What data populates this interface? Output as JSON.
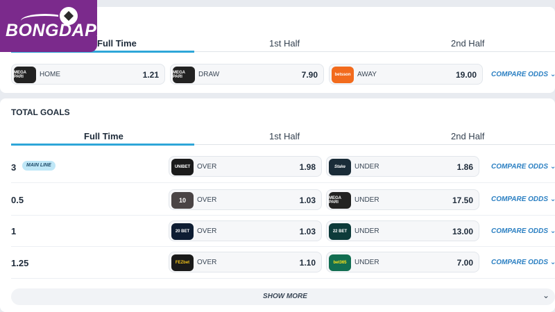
{
  "logo": {
    "text": "BONGDAPI"
  },
  "tabs": [
    "Full Time",
    "1st Half",
    "2nd Half"
  ],
  "top_market": {
    "home": {
      "bookmaker": "MEGA PARI",
      "label": "HOME",
      "value": "1.21"
    },
    "draw": {
      "bookmaker": "MEGA PARI",
      "label": "DRAW",
      "value": "7.90"
    },
    "away": {
      "bookmaker": "betsson",
      "label": "AWAY",
      "value": "19.00"
    },
    "compare": "COMPARE ODDS"
  },
  "total_goals": {
    "title": "TOTAL GOALS",
    "main_badge": "MAIN LINE",
    "compare": "COMPARE ODDS",
    "rows": [
      {
        "line": "3",
        "over_bm": "UNIBET",
        "over_label": "OVER",
        "over": "1.98",
        "under_bm": "Stake",
        "under_label": "UNDER",
        "under": "1.86"
      },
      {
        "line": "0.5",
        "over_bm": "10",
        "over_label": "OVER",
        "over": "1.03",
        "under_bm": "MEGA PARI",
        "under_label": "UNDER",
        "under": "17.50"
      },
      {
        "line": "1",
        "over_bm": "20 BET",
        "over_label": "OVER",
        "over": "1.03",
        "under_bm": "22 BET",
        "under_label": "UNDER",
        "under": "13.00"
      },
      {
        "line": "1.25",
        "over_bm": "FEZbet",
        "over_label": "OVER",
        "over": "1.10",
        "under_bm": "bet365",
        "under_label": "UNDER",
        "under": "7.00"
      }
    ],
    "show_more": "SHOW MORE"
  },
  "colors": {
    "accent": "#2ea6d8",
    "link": "#2a7fc2",
    "logo_bg": "#7b2a8c"
  }
}
